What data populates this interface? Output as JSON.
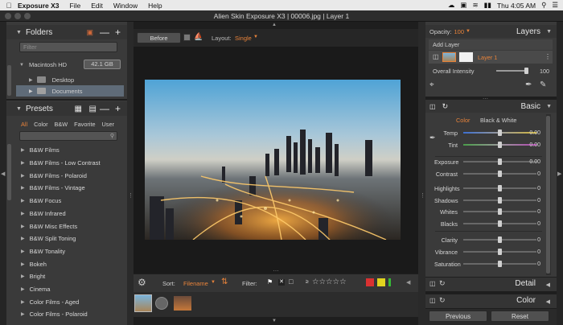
{
  "menubar": {
    "app": "Exposure X3",
    "items": [
      "File",
      "Edit",
      "Window",
      "Help"
    ],
    "time": "Thu 4:05 AM"
  },
  "window": {
    "title": "Alien Skin Exposure X3 | 00006.jpg | Layer 1"
  },
  "folders": {
    "title": "Folders",
    "filter_placeholder": "Filter",
    "drive": {
      "name": "Macintosh HD",
      "size": "42.1 GB"
    },
    "items": [
      "Desktop",
      "Documents"
    ]
  },
  "presets": {
    "title": "Presets",
    "tabs": [
      "All",
      "Color",
      "B&W",
      "Favorite",
      "User"
    ],
    "active_tab": "All",
    "items": [
      "B&W Films",
      "B&W Films - Low Contrast",
      "B&W Films - Polaroid",
      "B&W Films - Vintage",
      "B&W Focus",
      "B&W Infrared",
      "B&W Misc Effects",
      "B&W Split Toning",
      "B&W Tonality",
      "Bokeh",
      "Bright",
      "Cinema",
      "Color Films - Aged",
      "Color Films - Polaroid"
    ]
  },
  "toolbar": {
    "before_label": "Before",
    "layout_label": "Layout:",
    "layout_value": "Single"
  },
  "bottombar": {
    "sort_label": "Sort:",
    "sort_value": "Filename",
    "filter_label": "Filter:",
    "rating_prefix": "≥",
    "color_swatches": [
      "#d93131",
      "#e0d31f",
      "#36b836"
    ]
  },
  "layers": {
    "opacity_label": "Opacity:",
    "opacity_value": "100",
    "title": "Layers",
    "add_layer": "Add Layer",
    "layer_name": "Layer 1",
    "overall_intensity_label": "Overall Intensity",
    "overall_intensity_value": "100"
  },
  "basic": {
    "title": "Basic",
    "mode_color": "Color",
    "mode_bw": "Black & White",
    "sliders": [
      {
        "label": "Temp",
        "value": "0.00"
      },
      {
        "label": "Tint",
        "value": "0.00"
      },
      {
        "label": "Exposure",
        "value": "0.00"
      },
      {
        "label": "Contrast",
        "value": "0"
      },
      {
        "label": "Highlights",
        "value": "0"
      },
      {
        "label": "Shadows",
        "value": "0"
      },
      {
        "label": "Whites",
        "value": "0"
      },
      {
        "label": "Blacks",
        "value": "0"
      },
      {
        "label": "Clarity",
        "value": "0"
      },
      {
        "label": "Vibrance",
        "value": "0"
      },
      {
        "label": "Saturation",
        "value": "0"
      }
    ]
  },
  "detail": {
    "title": "Detail"
  },
  "color_panel": {
    "title": "Color"
  },
  "footer": {
    "previous_label": "Previous",
    "reset_label": "Reset"
  },
  "colors": {
    "accent": "#e8833a",
    "selected_row": "#5f6b78"
  }
}
